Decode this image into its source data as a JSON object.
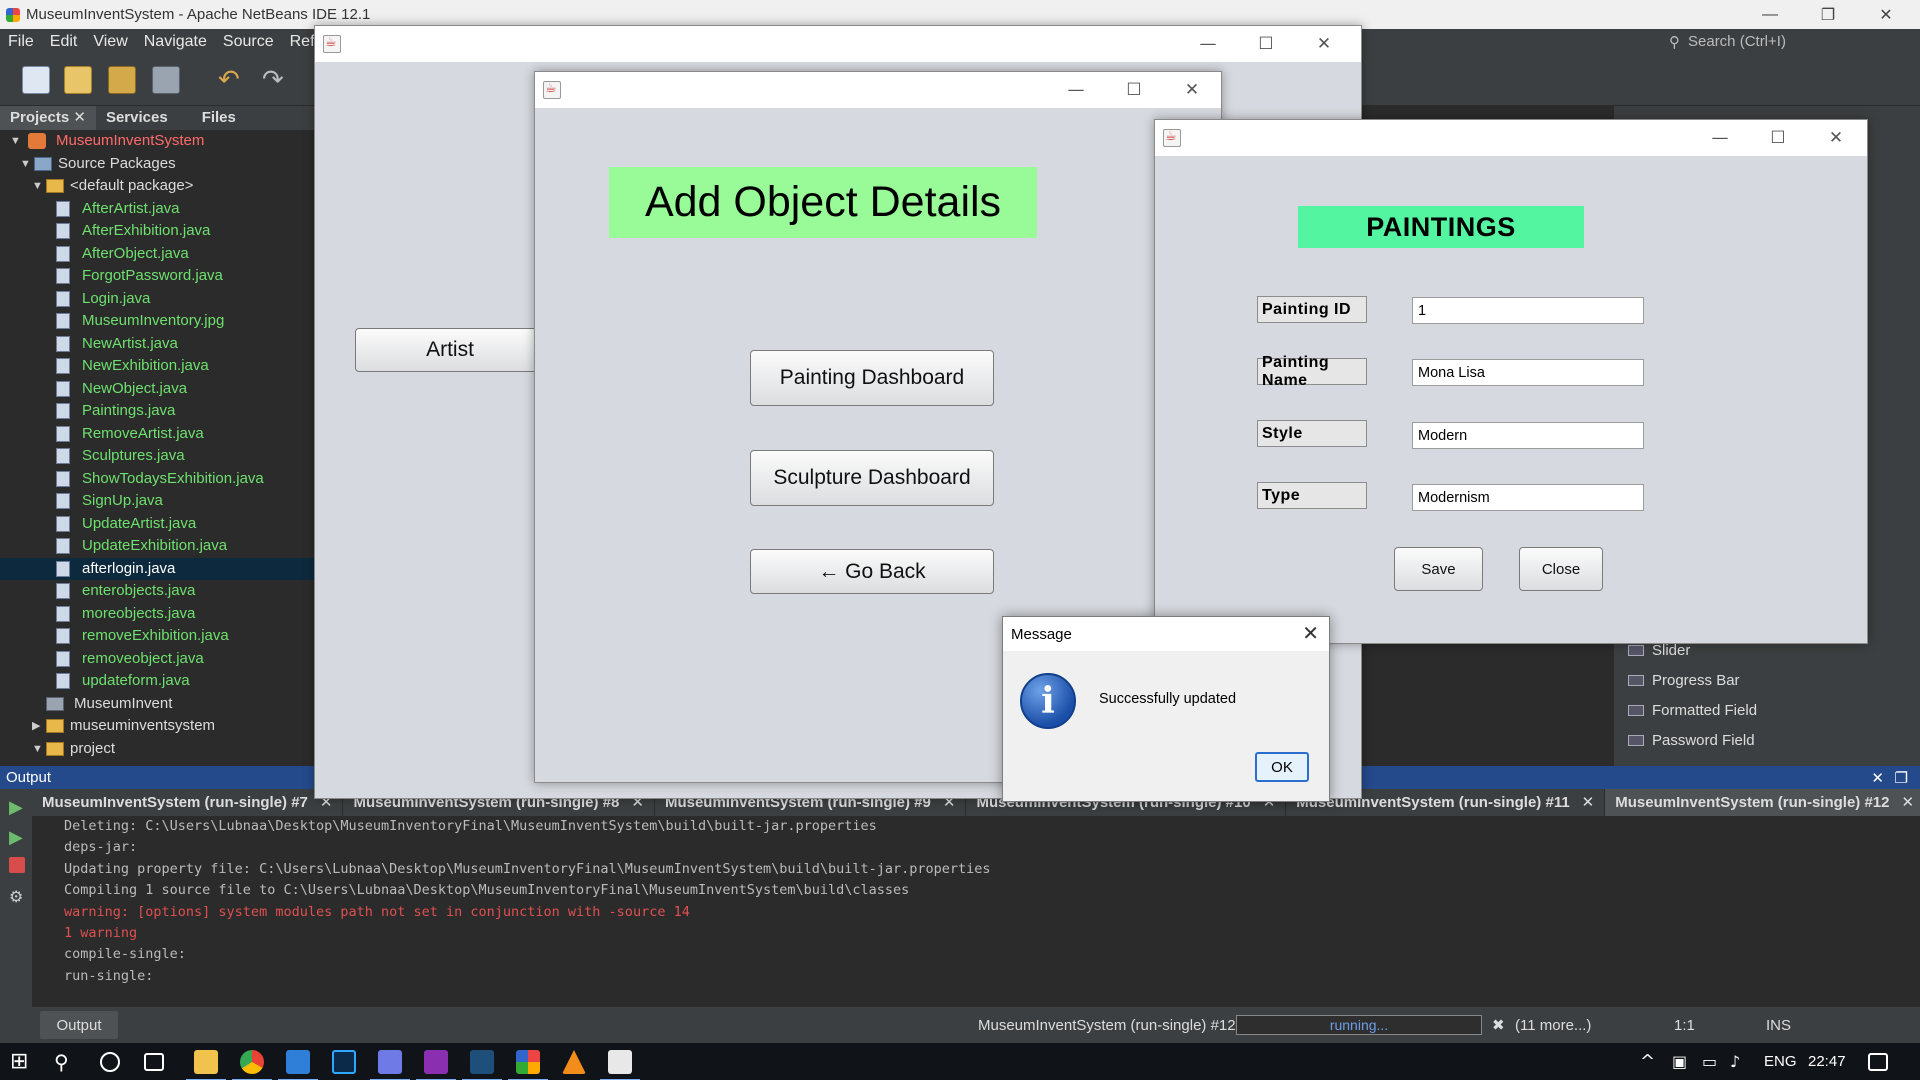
{
  "ide": {
    "title": "MuseumInventSystem - Apache NetBeans IDE 12.1",
    "menu": [
      "File",
      "Edit",
      "View",
      "Navigate",
      "Source",
      "Refact"
    ],
    "search_placeholder": "Search (Ctrl+I)",
    "panel_tabs": [
      "Projects",
      "Services",
      "Files"
    ],
    "project_name": "MuseumInventSystem",
    "source_packages": "Source Packages",
    "default_package": "<default package>",
    "files": [
      "AfterArtist.java",
      "AfterExhibition.java",
      "AfterObject.java",
      "ForgotPassword.java",
      "Login.java",
      "MuseumInventory.jpg",
      "NewArtist.java",
      "NewExhibition.java",
      "NewObject.java",
      "Paintings.java",
      "RemoveArtist.java",
      "Sculptures.java",
      "ShowTodaysExhibition.java",
      "SignUp.java",
      "UpdateArtist.java",
      "UpdateExhibition.java",
      "afterlogin.java",
      "enterobjects.java",
      "moreobjects.java",
      "removeExhibition.java",
      "removeobject.java",
      "updateform.java"
    ],
    "selected_file": "afterlogin.java",
    "other_nodes": [
      "MuseumInvent",
      "museuminventsystem",
      "project"
    ],
    "palette_items": [
      "Slider",
      "Progress Bar",
      "Formatted Field",
      "Password Field"
    ],
    "output_label": "Output",
    "output_tabs": [
      "MuseumInventSystem (run-single) #7",
      "MuseumInventSystem (run-single) #8",
      "MuseumInventSystem (run-single) #9",
      "MuseumInventSystem (run-single) #10",
      "MuseumInventSystem (run-single) #11",
      "MuseumInventSystem (run-single) #12"
    ],
    "console_lines": [
      {
        "text": "Deleting: C:\\Users\\Lubnaa\\Desktop\\MuseumInventoryFinal\\MuseumInventSystem\\build\\built-jar.properties",
        "warn": false
      },
      {
        "text": "deps-jar:",
        "warn": false
      },
      {
        "text": "Updating property file: C:\\Users\\Lubnaa\\Desktop\\MuseumInventoryFinal\\MuseumInventSystem\\build\\built-jar.properties",
        "warn": false
      },
      {
        "text": "Compiling 1 source file to C:\\Users\\Lubnaa\\Desktop\\MuseumInventoryFinal\\MuseumInventSystem\\build\\classes",
        "warn": false
      },
      {
        "text": "warning: [options] system modules path not set in conjunction with -source 14",
        "warn": true
      },
      {
        "text": "1 warning",
        "warn": true
      },
      {
        "text": "compile-single:",
        "warn": false
      },
      {
        "text": "run-single:",
        "warn": false
      }
    ],
    "status": {
      "output_tab": "Output",
      "task": "MuseumInventSystem (run-single) #12",
      "progress_text": "running...",
      "more": "(11 more...)",
      "position": "1:1",
      "mode": "INS"
    }
  },
  "back_window": {
    "artist_button": "Artist"
  },
  "add_object": {
    "banner": "Add Object Details",
    "painting_button": "Painting Dashboard",
    "sculpture_button": "Sculpture Dashboard",
    "back_button": "← Go Back"
  },
  "paintings": {
    "banner": "PAINTINGS",
    "fields": [
      {
        "label": "Painting ID",
        "value": "1"
      },
      {
        "label": "Painting Name",
        "value": "Mona Lisa"
      },
      {
        "label": "Style",
        "value": "Modern"
      },
      {
        "label": "Type",
        "value": "Modernism"
      }
    ],
    "save_button": "Save",
    "close_button": "Close"
  },
  "message": {
    "title": "Message",
    "text": "Successfully updated",
    "ok_button": "OK"
  },
  "taskbar": {
    "language": "ENG",
    "time": "22:47"
  },
  "colors": {
    "add_banner": "#98fb98",
    "paintings_banner": "#54f5a0",
    "file_green": "#6ee06e",
    "output_header": "#244a8c"
  }
}
